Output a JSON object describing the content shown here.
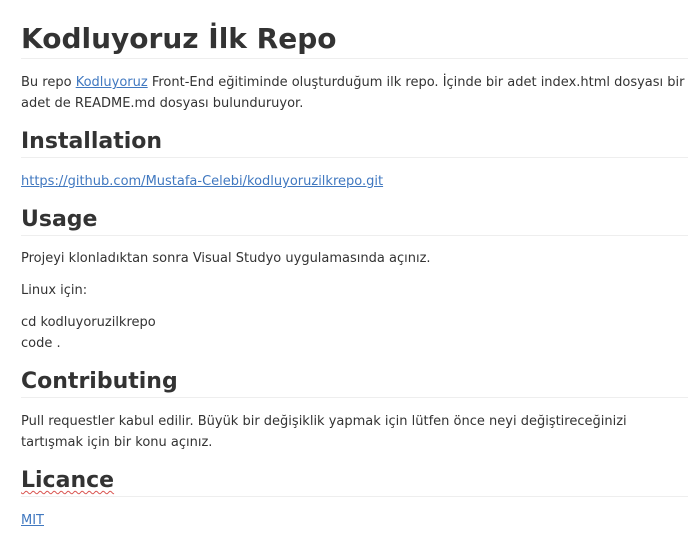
{
  "title": "Kodluyoruz İlk Repo",
  "intro": {
    "prefix": "Bu repo ",
    "link_text": "Kodluyoruz",
    "suffix": " Front-End eğitiminde oluşturduğum ilk repo. İçinde bir adet index.html dosyası bir adet de README.md dosyası bulunduruyor."
  },
  "installation": {
    "heading": "Installation",
    "link": "https://github.com/Mustafa-Celebi/kodluyoruzilkrepo.git"
  },
  "usage": {
    "heading": "Usage",
    "text": "Projeyi klonladıktan sonra Visual Studyo uygulamasında açınız.",
    "linux_label": "Linux için:",
    "cmd1": "cd kodluyoruzilkrepo",
    "cmd2": "code ."
  },
  "contributing": {
    "heading": "Contributing",
    "text": "Pull requestler kabul edilir. Büyük bir değişiklik yapmak için lütfen önce neyi değiştireceğinizi tartışmak için bir konu açınız."
  },
  "licence": {
    "heading": "Licance",
    "link": "MIT"
  }
}
